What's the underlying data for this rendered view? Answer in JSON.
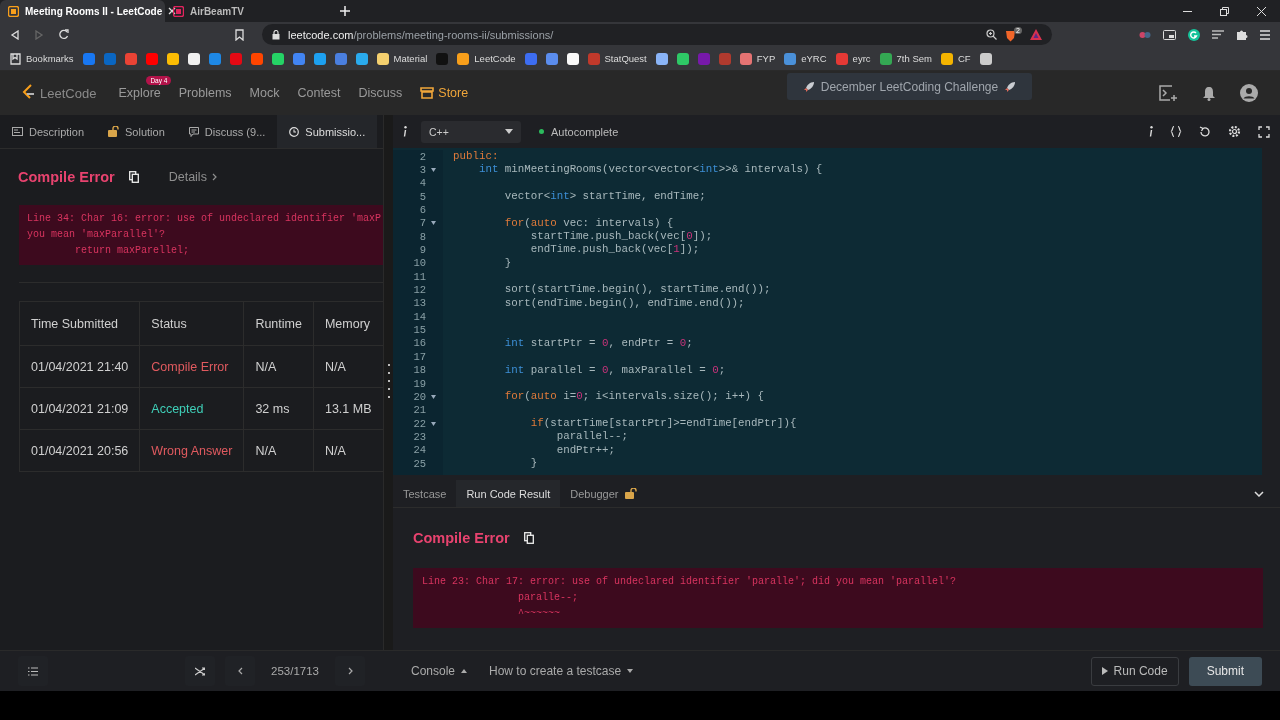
{
  "browser": {
    "tabs": [
      {
        "title": "Meeting Rooms II - LeetCode",
        "selected": true,
        "color": "#f89f1b"
      },
      {
        "title": "AirBeamTV",
        "selected": false,
        "color": "#e0245e"
      }
    ],
    "address": {
      "domain": "leetcode.com",
      "path": "/problems/meeting-rooms-ii/submissions/"
    },
    "shield_count": "2",
    "bookmarks": [
      {
        "kind": "folder",
        "label": "Bookmarks"
      },
      {
        "kind": "icon",
        "color": "#1877f2"
      },
      {
        "kind": "icon",
        "color": "#0a66c2"
      },
      {
        "kind": "icon",
        "color": "#ea4335"
      },
      {
        "kind": "icon",
        "color": "#ff0000"
      },
      {
        "kind": "icon",
        "color": "#fbbc04"
      },
      {
        "kind": "icon",
        "color": "#f0f0f0"
      },
      {
        "kind": "icon",
        "color": "#1e88e5"
      },
      {
        "kind": "icon",
        "color": "#e50914"
      },
      {
        "kind": "icon",
        "color": "#ff4500"
      },
      {
        "kind": "icon",
        "color": "#25d366"
      },
      {
        "kind": "icon",
        "color": "#4285f4"
      },
      {
        "kind": "icon",
        "color": "#1da1f2"
      },
      {
        "kind": "icon",
        "color": "#4a7fe0"
      },
      {
        "kind": "icon",
        "color": "#2aabee"
      },
      {
        "kind": "labeled",
        "label": "Material",
        "color": "#f4d06f"
      },
      {
        "kind": "icon",
        "color": "#111111"
      },
      {
        "kind": "labeled",
        "label": "LeetCode",
        "color": "#f89f1b"
      },
      {
        "kind": "icon",
        "color": "#3d6df2"
      },
      {
        "kind": "icon",
        "color": "#5b8def"
      },
      {
        "kind": "icon",
        "color": "#fafafa"
      },
      {
        "kind": "labeled",
        "label": "StatQuest",
        "color": "#c0392b"
      },
      {
        "kind": "icon",
        "color": "#8ab4f8"
      },
      {
        "kind": "icon",
        "color": "#2ec866"
      },
      {
        "kind": "icon",
        "color": "#7719aa"
      },
      {
        "kind": "icon",
        "color": "#b03a2e"
      },
      {
        "kind": "labeled",
        "label": "FYP",
        "color": "#e57373"
      },
      {
        "kind": "labeled",
        "label": "eYRC",
        "color": "#4a90d9"
      },
      {
        "kind": "labeled",
        "label": "eyrc",
        "color": "#e53935"
      },
      {
        "kind": "labeled",
        "label": "7th Sem",
        "color": "#34a853"
      },
      {
        "kind": "labeled",
        "label": "CF",
        "color": "#f4b400"
      },
      {
        "kind": "icon",
        "color": "#cccccc"
      }
    ]
  },
  "nav": {
    "logo": "LeetCode",
    "items": [
      {
        "kind": "link",
        "label": "Explore",
        "badge": "Day 4"
      },
      {
        "kind": "link",
        "label": "Problems"
      },
      {
        "kind": "link",
        "label": "Mock"
      },
      {
        "kind": "link",
        "label": "Contest"
      },
      {
        "kind": "link",
        "label": "Discuss"
      },
      {
        "kind": "store",
        "label": "Store"
      }
    ],
    "banner": "December LeetCoding Challenge"
  },
  "left": {
    "tabs": [
      {
        "label": "Description",
        "selected": false
      },
      {
        "label": "Solution",
        "selected": false
      },
      {
        "label": "Discuss (9...",
        "selected": false
      },
      {
        "label": "Submissio...",
        "selected": true
      }
    ],
    "result": {
      "status": "Compile Error",
      "details": "Details",
      "error_lines": [
        "Line 34: Char 16: error: use of undeclared identifier 'maxP",
        "you mean 'maxParallel'?",
        "        return maxParellel;"
      ]
    },
    "table": {
      "columns": [
        "Time Submitted",
        "Status",
        "Runtime",
        "Memory"
      ],
      "rows": [
        {
          "time": "01/04/2021 21:40",
          "status": "Compile Error",
          "color": "#e05a5f",
          "runtime": "N/A",
          "memory": "N/A"
        },
        {
          "time": "01/04/2021 21:09",
          "status": "Accepted",
          "color": "#3fcfb8",
          "runtime": "32 ms",
          "memory": "13.1 MB"
        },
        {
          "time": "01/04/2021 20:56",
          "status": "Wrong Answer",
          "color": "#e05a5f",
          "runtime": "N/A",
          "memory": "N/A"
        }
      ]
    }
  },
  "editor": {
    "language": "C++",
    "autocomplete": {
      "label": "Autocomplete",
      "on": true
    },
    "lines": [
      {
        "number": "2",
        "tokens": [
          {
            "kind": "kw",
            "t": "public:"
          }
        ]
      },
      {
        "number": "3",
        "foldable": true,
        "tokens": [
          {
            "kind": "type",
            "t": "    int"
          },
          {
            "kind": "plain",
            "t": " minMeetingRooms(vector<vector<"
          },
          {
            "kind": "type",
            "t": "int"
          },
          {
            "kind": "plain",
            "t": ">>& intervals) {"
          }
        ]
      },
      {
        "number": "4"
      },
      {
        "number": "5",
        "tokens": [
          {
            "kind": "plain",
            "t": "        vector<"
          },
          {
            "kind": "type",
            "t": "int"
          },
          {
            "kind": "plain",
            "t": "> startTime, endTime;"
          }
        ]
      },
      {
        "number": "6"
      },
      {
        "number": "7",
        "foldable": true,
        "tokens": [
          {
            "kind": "kw",
            "t": "        for"
          },
          {
            "kind": "plain",
            "t": "("
          },
          {
            "kind": "kw",
            "t": "auto"
          },
          {
            "kind": "plain",
            "t": " vec: intervals) {"
          }
        ]
      },
      {
        "number": "8",
        "tokens": [
          {
            "kind": "plain",
            "t": "            startTime.push_back(vec["
          },
          {
            "kind": "num",
            "t": "0"
          },
          {
            "kind": "plain",
            "t": "]);"
          }
        ]
      },
      {
        "number": "9",
        "tokens": [
          {
            "kind": "plain",
            "t": "            endTime.push_back(vec["
          },
          {
            "kind": "num",
            "t": "1"
          },
          {
            "kind": "plain",
            "t": "]);"
          }
        ]
      },
      {
        "number": "10",
        "tokens": [
          {
            "kind": "plain",
            "t": "        }"
          }
        ]
      },
      {
        "number": "11"
      },
      {
        "number": "12",
        "tokens": [
          {
            "kind": "plain",
            "t": "        sort(startTime.begin(), startTime.end());"
          }
        ]
      },
      {
        "number": "13",
        "tokens": [
          {
            "kind": "plain",
            "t": "        sort(endTime.begin(), endTime.end());"
          }
        ]
      },
      {
        "number": "14"
      },
      {
        "number": "15"
      },
      {
        "number": "16",
        "tokens": [
          {
            "kind": "type",
            "t": "        int"
          },
          {
            "kind": "plain",
            "t": " startPtr = "
          },
          {
            "kind": "num",
            "t": "0"
          },
          {
            "kind": "plain",
            "t": ", endPtr = "
          },
          {
            "kind": "num",
            "t": "0"
          },
          {
            "kind": "plain",
            "t": ";"
          }
        ]
      },
      {
        "number": "17"
      },
      {
        "number": "18",
        "tokens": [
          {
            "kind": "type",
            "t": "        int"
          },
          {
            "kind": "plain",
            "t": " parallel = "
          },
          {
            "kind": "num",
            "t": "0"
          },
          {
            "kind": "plain",
            "t": ", maxParallel = "
          },
          {
            "kind": "num",
            "t": "0"
          },
          {
            "kind": "plain",
            "t": ";"
          }
        ]
      },
      {
        "number": "19"
      },
      {
        "number": "20",
        "foldable": true,
        "tokens": [
          {
            "kind": "kw",
            "t": "        for"
          },
          {
            "kind": "plain",
            "t": "("
          },
          {
            "kind": "kw",
            "t": "auto"
          },
          {
            "kind": "plain",
            "t": " i="
          },
          {
            "kind": "num",
            "t": "0"
          },
          {
            "kind": "plain",
            "t": "; i<intervals.size(); i++) {"
          }
        ]
      },
      {
        "number": "21"
      },
      {
        "number": "22",
        "foldable": true,
        "tokens": [
          {
            "kind": "kw",
            "t": "            if"
          },
          {
            "kind": "plain",
            "t": "(startTime[startPtr]>=endTime[endPtr]){"
          }
        ]
      },
      {
        "number": "23",
        "tokens": [
          {
            "kind": "plain",
            "t": "                parallel--;"
          }
        ]
      },
      {
        "number": "24",
        "tokens": [
          {
            "kind": "plain",
            "t": "                endPtr++;"
          }
        ]
      },
      {
        "number": "25",
        "tokens": [
          {
            "kind": "plain",
            "t": "            }"
          }
        ]
      }
    ]
  },
  "console": {
    "tabs": [
      {
        "label": "Testcase",
        "selected": false
      },
      {
        "label": "Run Code Result",
        "selected": true
      },
      {
        "label": "Debugger",
        "selected": false,
        "locked": true
      }
    ],
    "status": "Compile Error",
    "error_lines": [
      "Line 23: Char 17: error: use of undeclared identifier 'paralle'; did you mean 'parallel'?",
      "                paralle--;",
      "                ^~~~~~~"
    ]
  },
  "footer": {
    "counter": "253/1713",
    "console": "Console",
    "testcase_help": "How to create a testcase",
    "run": "Run Code",
    "submit": "Submit"
  }
}
